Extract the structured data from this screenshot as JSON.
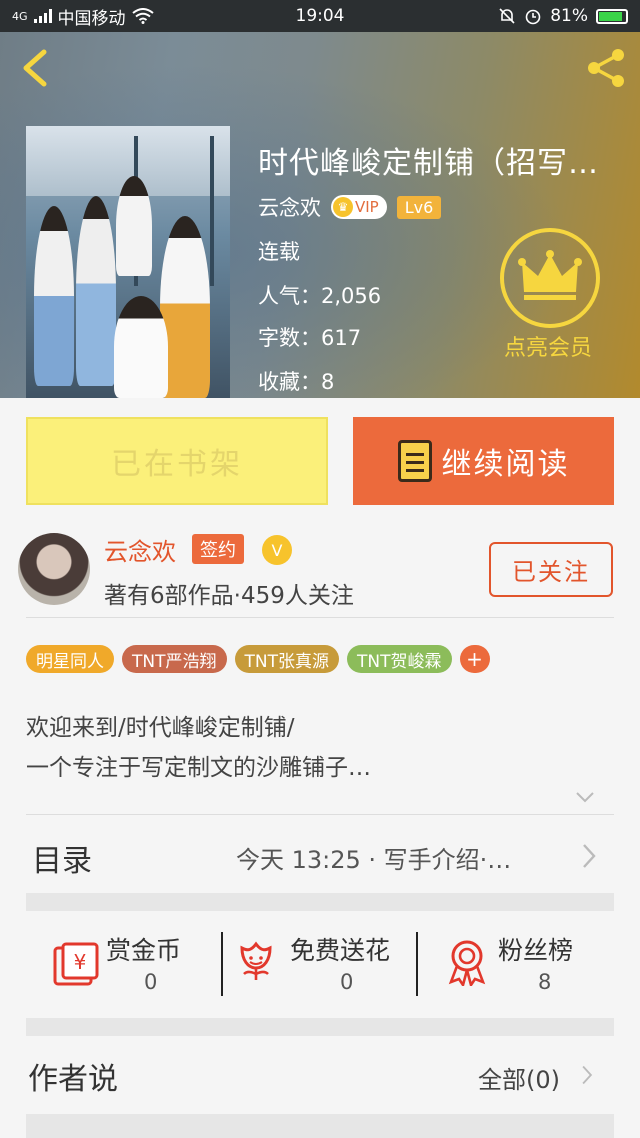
{
  "status_bar": {
    "network": "4G",
    "carrier": "中国移动",
    "time": "19:04",
    "battery": "81%"
  },
  "book": {
    "title": "时代峰峻定制铺（招写…",
    "author": "云念欢",
    "vip_label": "VIP",
    "level": "Lv6",
    "status": "连载",
    "popularity_label": "人气：",
    "popularity": "2,056",
    "words_label": "字数：",
    "words": "617",
    "favorites_label": "收藏：",
    "favorites": "8",
    "member_label": "点亮会员"
  },
  "actions": {
    "shelf_label": "已在书架",
    "read_label": "继续阅读"
  },
  "author_card": {
    "name": "云念欢",
    "sign_tag": "签约",
    "verified": "V",
    "stats": "著有6部作品·459人关注",
    "follow_label": "已关注"
  },
  "tags": [
    {
      "label": "明星同人",
      "color": "#f0a92a"
    },
    {
      "label": "TNT严浩翔",
      "color": "#c8694c"
    },
    {
      "label": "TNT张真源",
      "color": "#c79b3a"
    },
    {
      "label": "TNT贺峻霖",
      "color": "#8cbc5a"
    }
  ],
  "tag_more": "+",
  "intro": {
    "line1": "欢迎来到/时代峰峻定制铺/",
    "line2": "一个专注于写定制文的沙雕铺子…"
  },
  "toc": {
    "label": "目录",
    "latest": "今天 13:25 · 写手介绍·…"
  },
  "stats": [
    {
      "label": "赏金币",
      "value": "0",
      "icon": "red-envelope-icon"
    },
    {
      "label": "免费送花",
      "value": "0",
      "icon": "flower-icon"
    },
    {
      "label": "粉丝榜",
      "value": "8",
      "icon": "ribbon-medal-icon"
    }
  ],
  "author_says": {
    "label": "作者说",
    "all_link": "全部(0)"
  },
  "colors": {
    "accent": "#ec6a3c",
    "shelf": "#fbf07a",
    "member": "#f6d63f"
  }
}
